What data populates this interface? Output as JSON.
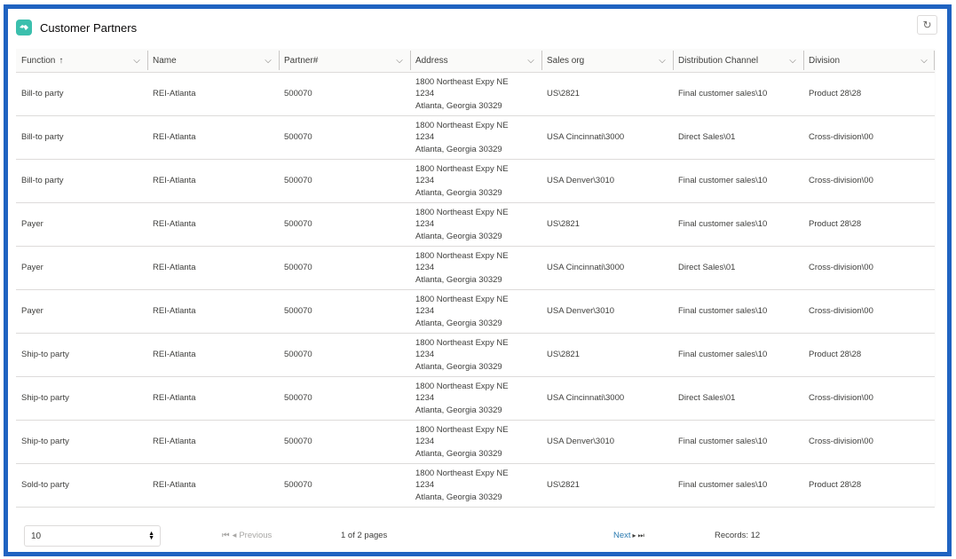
{
  "header": {
    "title": "Customer Partners",
    "icon": "handshake-icon",
    "refresh_icon": "refresh-icon"
  },
  "table": {
    "columns": [
      {
        "label": "Function",
        "sorted": "ascending",
        "sort_icon": "↑"
      },
      {
        "label": "Name"
      },
      {
        "label": "Partner#"
      },
      {
        "label": "Address"
      },
      {
        "label": "Sales org"
      },
      {
        "label": "Distribution Channel"
      },
      {
        "label": "Division"
      }
    ],
    "rows": [
      {
        "function": "Bill-to party",
        "name": "REI-Atlanta",
        "partner": "500070",
        "address": [
          "1800 Northeast Expy NE",
          "1234",
          "Atlanta, Georgia 30329"
        ],
        "sales_org": "US\\2821",
        "dist_channel": "Final customer sales\\10",
        "division": "Product 28\\28"
      },
      {
        "function": "Bill-to party",
        "name": "REI-Atlanta",
        "partner": "500070",
        "address": [
          "1800 Northeast Expy NE",
          "1234",
          "Atlanta, Georgia 30329"
        ],
        "sales_org": "USA Cincinnati\\3000",
        "dist_channel": "Direct Sales\\01",
        "division": "Cross-division\\00"
      },
      {
        "function": "Bill-to party",
        "name": "REI-Atlanta",
        "partner": "500070",
        "address": [
          "1800 Northeast Expy NE",
          "1234",
          "Atlanta, Georgia 30329"
        ],
        "sales_org": "USA Denver\\3010",
        "dist_channel": "Final customer sales\\10",
        "division": "Cross-division\\00"
      },
      {
        "function": "Payer",
        "name": "REI-Atlanta",
        "partner": "500070",
        "address": [
          "1800 Northeast Expy NE",
          "1234",
          "Atlanta, Georgia 30329"
        ],
        "sales_org": "US\\2821",
        "dist_channel": "Final customer sales\\10",
        "division": "Product 28\\28"
      },
      {
        "function": "Payer",
        "name": "REI-Atlanta",
        "partner": "500070",
        "address": [
          "1800 Northeast Expy NE",
          "1234",
          "Atlanta, Georgia 30329"
        ],
        "sales_org": "USA Cincinnati\\3000",
        "dist_channel": "Direct Sales\\01",
        "division": "Cross-division\\00"
      },
      {
        "function": "Payer",
        "name": "REI-Atlanta",
        "partner": "500070",
        "address": [
          "1800 Northeast Expy NE",
          "1234",
          "Atlanta, Georgia 30329"
        ],
        "sales_org": "USA Denver\\3010",
        "dist_channel": "Final customer sales\\10",
        "division": "Cross-division\\00"
      },
      {
        "function": "Ship-to party",
        "name": "REI-Atlanta",
        "partner": "500070",
        "address": [
          "1800 Northeast Expy NE",
          "1234",
          "Atlanta, Georgia 30329"
        ],
        "sales_org": "US\\2821",
        "dist_channel": "Final customer sales\\10",
        "division": "Product 28\\28"
      },
      {
        "function": "Ship-to party",
        "name": "REI-Atlanta",
        "partner": "500070",
        "address": [
          "1800 Northeast Expy NE",
          "1234",
          "Atlanta, Georgia 30329"
        ],
        "sales_org": "USA Cincinnati\\3000",
        "dist_channel": "Direct Sales\\01",
        "division": "Cross-division\\00"
      },
      {
        "function": "Ship-to party",
        "name": "REI-Atlanta",
        "partner": "500070",
        "address": [
          "1800 Northeast Expy NE",
          "1234",
          "Atlanta, Georgia 30329"
        ],
        "sales_org": "USA Denver\\3010",
        "dist_channel": "Final customer sales\\10",
        "division": "Cross-division\\00"
      },
      {
        "function": "Sold-to party",
        "name": "REI-Atlanta",
        "partner": "500070",
        "address": [
          "1800 Northeast Expy NE",
          "1234",
          "Atlanta, Georgia 30329"
        ],
        "sales_org": "US\\2821",
        "dist_channel": "Final customer sales\\10",
        "division": "Product 28\\28"
      }
    ]
  },
  "footer": {
    "page_size": "10",
    "previous_label": "Previous",
    "page_info": "1 of 2 pages",
    "next_label": "Next",
    "records_label": "Records: 12"
  },
  "colors": {
    "frame_border": "#1f63c1",
    "app_icon": "#3bbfad",
    "link": "#2a7ab0"
  }
}
